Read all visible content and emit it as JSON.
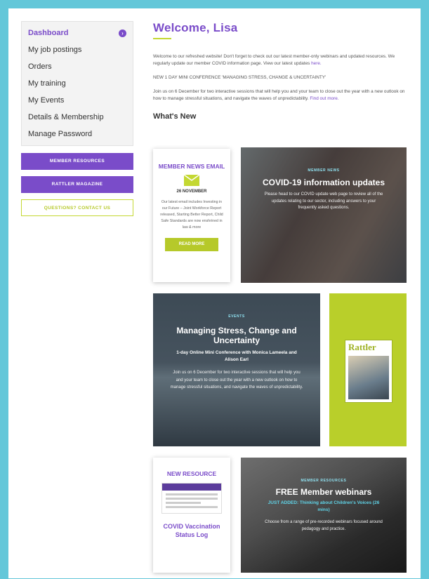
{
  "sidebar": {
    "menu": [
      {
        "label": "Dashboard",
        "active": true
      },
      {
        "label": "My job postings"
      },
      {
        "label": "Orders"
      },
      {
        "label": "My training"
      },
      {
        "label": "My Events"
      },
      {
        "label": "Details & Membership"
      },
      {
        "label": "Manage Password"
      }
    ],
    "member_resources": "MEMBER RESOURCES",
    "rattler_magazine": "RATTLER MAGAZINE",
    "contact": "QUESTIONS? CONTACT US"
  },
  "main": {
    "welcome": "Welcome, Lisa",
    "intro_text": "Welcome to our refreshed website! Don't forget to check out our latest member-only webinars and updated resources. We regularly update our member COVID information page. View our latest updates",
    "intro_link": "here.",
    "conference_heading": "NEW 1 DAY MINI CONFERENCE 'MANAGING STRESS, CHANGE & UNCERTAINTY'",
    "conference_text": "Join us on 6 December for two interactive sessions that will help you and your team to close out the year with a new outlook on how to manage stressful situations, and navigate the waves of unpredictability.",
    "conference_link": "Find out more.",
    "whats_new": "What's New"
  },
  "cards": {
    "news_email": {
      "title": "MEMBER NEWS EMAIL",
      "date": "26 NOVEMBER",
      "text": "Our latest email includes Investing in our Future – Joint Workforce Report released, Starting Better Report, Child Safe Standards are now enshrined in law & more",
      "button": "READ MORE"
    },
    "covid": {
      "tag": "MEMBER NEWS",
      "title": "COVID-19 information updates",
      "text": "Please head to our COVID update web page to review all of the updates relating to our sector, including answers to your frequently asked questions."
    },
    "stress": {
      "tag": "EVENTS",
      "title": "Managing Stress, Change and Uncertainty",
      "subtitle": "1-day Online Mini Conference with Monica Lameela and Alison Earl",
      "text": "Join us on 6 December for two interactive sessions that will help you and your team to close out the year with a new outlook on how to manage stressful situations, and navigate the waves of unpredictability."
    },
    "rattler": {
      "logo": "Rattler"
    },
    "new_resource": {
      "title": "NEW RESOURCE",
      "name": "COVID Vaccination Status Log"
    },
    "webinars": {
      "tag": "MEMBER RESOURCES",
      "title": "FREE Member webinars",
      "highlight": "JUST ADDED: Thinking about Children's Voices (26 mins)",
      "text": "Choose from a range of pre-recorded webinars focused around pedagogy and practice."
    }
  },
  "colors": {
    "frame": "#63c7d9",
    "purple": "#7a4cc9",
    "lime": "#c4d832"
  }
}
